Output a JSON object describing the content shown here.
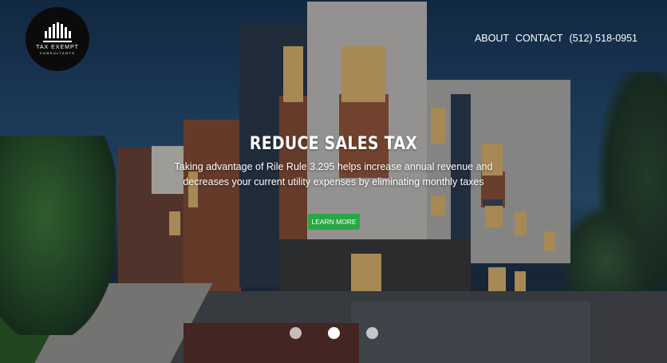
{
  "logo": {
    "line1": "TAX EXEMPT",
    "line2": "CONSULTANTS"
  },
  "nav": {
    "items": [
      "ABOUT",
      "CONTACT",
      "(512) 518-0951"
    ]
  },
  "hero": {
    "headline": "REDUCE SALES TAX",
    "subtext": "Taking advantage of Rile Rule 3.295 helps increase annual revenue and decreases your current utility expenses by eliminating monthly taxes",
    "cta_label": "LEARN MORE",
    "cta_color": "#27a844",
    "background": "photo of modern townhouse building at dusk"
  },
  "carousel": {
    "slide_count": 3,
    "active_index": 1
  }
}
